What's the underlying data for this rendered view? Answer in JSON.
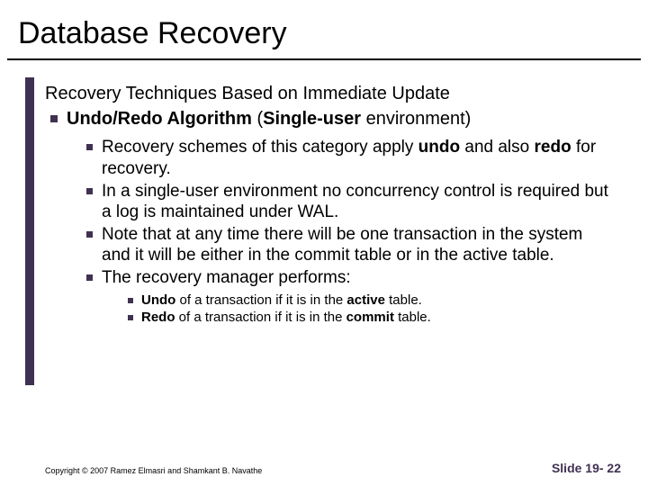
{
  "title": "Database Recovery",
  "subtitle": "Recovery Techniques Based on Immediate Update",
  "lvl1_html": "<b>Undo/Redo Algorithm</b> (<b>Single-user</b> environment)",
  "lvl2": [
    "Recovery schemes of this category apply <b>undo</b> and also <b>redo</b> for recovery.",
    "In a single-user environment no concurrency control is required but a log is maintained under WAL.",
    "Note that at any time there will be one transaction in the system and it will be either in the commit table or in the active table.",
    "The recovery manager performs:"
  ],
  "lvl3": [
    "<b>Undo</b> of a transaction if it is in the <b>active</b> table.",
    "<b>Redo</b> of a transaction if it is in the <b>commit</b> table."
  ],
  "copyright": "Copyright © 2007 Ramez Elmasri and Shamkant B. Navathe",
  "slidenum": "Slide 19- 22"
}
